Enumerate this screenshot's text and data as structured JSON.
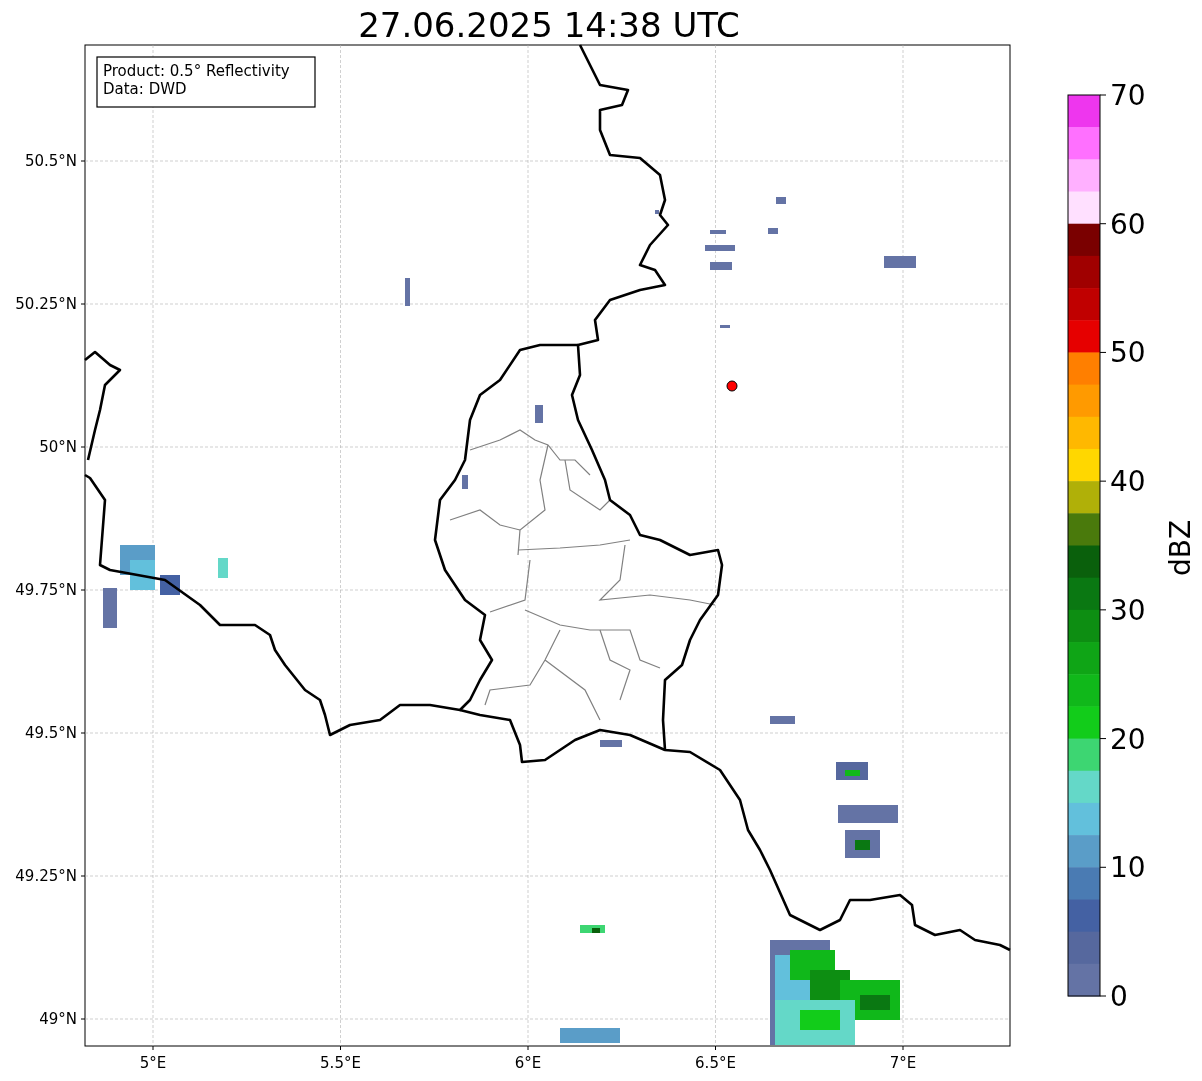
{
  "title": "27.06.2025 14:38 UTC",
  "info_box": [
    "Product: 0.5° Reflectivity",
    "Data: DWD"
  ],
  "map": {
    "x_ticks": [
      "5°E",
      "5.5°E",
      "6°E",
      "6.5°E",
      "7°E"
    ],
    "y_ticks": [
      "50.5°N",
      "50.25°N",
      "50°N",
      "49.75°N",
      "49.5°N",
      "49.25°N",
      "49°N"
    ]
  },
  "colorbar": {
    "label": "dBZ",
    "ticks": [
      "70",
      "60",
      "50",
      "40",
      "30",
      "20",
      "10",
      "0"
    ],
    "segments": [
      {
        "color": "#ee36ee"
      },
      {
        "color": "#ff70ff"
      },
      {
        "color": "#ffb0ff"
      },
      {
        "color": "#ffe0ff"
      },
      {
        "color": "#7a0000"
      },
      {
        "color": "#a00000"
      },
      {
        "color": "#c00000"
      },
      {
        "color": "#e60000"
      },
      {
        "color": "#ff7f00"
      },
      {
        "color": "#ff9a00"
      },
      {
        "color": "#ffb800"
      },
      {
        "color": "#ffd700"
      },
      {
        "color": "#b0b008"
      },
      {
        "color": "#4a7a0c"
      },
      {
        "color": "#0a600c"
      },
      {
        "color": "#0a7812"
      },
      {
        "color": "#0d8e12"
      },
      {
        "color": "#0fa516"
      },
      {
        "color": "#10b81a"
      },
      {
        "color": "#12cc1a"
      },
      {
        "color": "#3dd672"
      },
      {
        "color": "#64d8c8"
      },
      {
        "color": "#62c0dc"
      },
      {
        "color": "#5a9dc8"
      },
      {
        "color": "#4a7bb3"
      },
      {
        "color": "#4461a3"
      },
      {
        "color": "#56689e"
      },
      {
        "color": "#6473a5"
      }
    ]
  }
}
